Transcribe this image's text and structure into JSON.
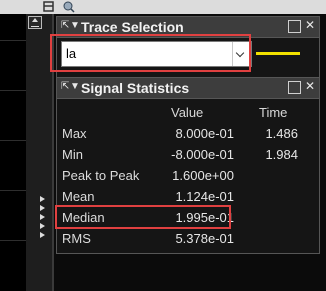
{
  "trace_selection": {
    "title": "Trace Selection",
    "selected_trace": "la",
    "line_color": "#f2e100",
    "highlight_color": "#e04040"
  },
  "signal_statistics": {
    "title": "Signal Statistics",
    "columns": {
      "value": "Value",
      "time": "Time"
    },
    "rows": [
      {
        "label": "Max",
        "value": "8.000e-01",
        "time": "1.486"
      },
      {
        "label": "Min",
        "value": "-8.000e-01",
        "time": "1.984"
      },
      {
        "label": "Peak to Peak",
        "value": "1.600e+00",
        "time": ""
      },
      {
        "label": "Mean",
        "value": "1.124e-01",
        "time": ""
      },
      {
        "label": "Median",
        "value": "1.995e-01",
        "time": ""
      },
      {
        "label": "RMS",
        "value": "5.378e-01",
        "time": ""
      }
    ]
  },
  "icons": {
    "header_left": "undock-and-menu-icons",
    "header_right": "dock-and-close-icons"
  }
}
